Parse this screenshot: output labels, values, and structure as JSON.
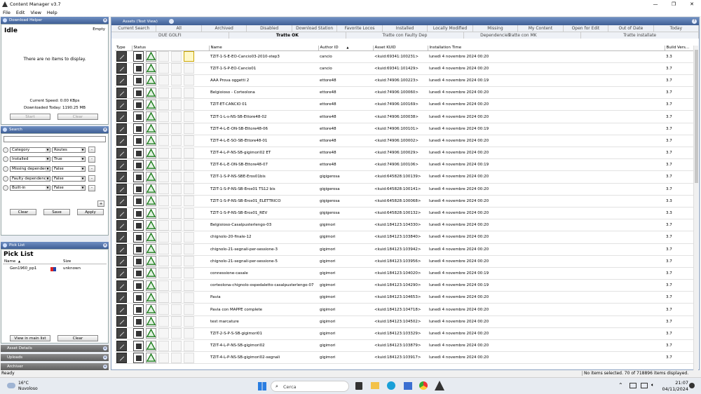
{
  "window": {
    "title": "Content Manager v3.7",
    "controls": [
      "—",
      "❐",
      "✕"
    ]
  },
  "menu": [
    "File",
    "Edit",
    "View",
    "Help"
  ],
  "download_helper": {
    "header": "Download Helper",
    "status": "Idle",
    "queue_state": "Empty",
    "empty_message": "There are no items to display.",
    "current_speed": "Current Speed: 0.00 KBps",
    "downloaded_today": "Downloaded Today: 1190.25 MB",
    "start_label": "Start",
    "clear_label": "Clear"
  },
  "search": {
    "header": "Search",
    "placeholder": "",
    "filters": [
      {
        "field": "Category",
        "value": "Routes"
      },
      {
        "field": "Installed",
        "value": "True"
      },
      {
        "field": "Missing dependenc",
        "value": "False"
      },
      {
        "field": "Faulty dependenci",
        "value": "False"
      },
      {
        "field": "Built-in",
        "value": "False"
      }
    ],
    "clear_label": "Clear",
    "save_label": "Save",
    "apply_label": "Apply"
  },
  "pick_list": {
    "header": "Pick List",
    "title": "Pick List",
    "columns": [
      "Name",
      "Size"
    ],
    "items": [
      {
        "name": "Gen1960_pp1",
        "size": "unknown"
      }
    ],
    "view_label": "View in main list",
    "clear_label": "Clear"
  },
  "collapsed_panels": [
    "Asset Details",
    "Uploads",
    "Archiver"
  ],
  "main": {
    "header": "Assets (Text View)",
    "tabs_row1": [
      "Current Search",
      "All",
      "Archived",
      "Disabled",
      "Download Station",
      "Favorite Locos",
      "Installed",
      "Locally Modified",
      "Missing Dependencies",
      "My Content",
      "Open for Edit",
      "Out of Date",
      "Today"
    ],
    "tabs_row2": [
      "DUE GOLFI",
      "Tratte OK",
      "Tratte con Faulty Dep",
      "Tratte con MK",
      "Tratte installate"
    ],
    "active_tab2": "Tratte OK",
    "columns": [
      "Type",
      "Status",
      "Name",
      "Author ID",
      "Asset KUID",
      "Installation Time",
      "Build Vers..."
    ],
    "rows": [
      {
        "name": "TZIT-1-S-E-EO-Cancio03-2010-step3",
        "author": "cancio",
        "kuid": "<kuid:69341:100231>",
        "time": "lunedì 4 novembre 2024 00:20",
        "build": "3.3",
        "warn": true
      },
      {
        "name": "TZIT-1-S-P-EO-Cancio01",
        "author": "cancio",
        "kuid": "<kuid:69341:101429>",
        "time": "lunedì 4 novembre 2024 00:20",
        "build": "3.7",
        "warn": false
      },
      {
        "name": "AAA Prova oggetti 2",
        "author": "ettore48",
        "kuid": "<kuid:74906:100223>",
        "time": "lunedì 4 novembre 2024 00:19",
        "build": "3.7",
        "warn": false
      },
      {
        "name": "Belgioioso - Corteolona",
        "author": "ettore48",
        "kuid": "<kuid:74906:100060>",
        "time": "lunedì 4 novembre 2024 00:20",
        "build": "3.7",
        "warn": false
      },
      {
        "name": "TZIT-ET-CANCIO 01",
        "author": "ettore48",
        "kuid": "<kuid:74906:100169>",
        "time": "lunedì 4 novembre 2024 00:20",
        "build": "3.7",
        "warn": false
      },
      {
        "name": "TZIT-1-L-s-NS-SB-Ettore48-02",
        "author": "ettore48",
        "kuid": "<kuid:74906:100038>",
        "time": "lunedì 4 novembre 2024 00:20",
        "build": "3.7",
        "warn": false
      },
      {
        "name": "TZIT-4-L-E-ON-SB-Ettore48-06",
        "author": "ettore48",
        "kuid": "<kuid:74906:100101>",
        "time": "lunedì 4 novembre 2024 00:19",
        "build": "3.7",
        "warn": false
      },
      {
        "name": "TZIT-4-L-E-SO-SB-Ettore48-01",
        "author": "ettore48",
        "kuid": "<kuid:74906:100002>",
        "time": "lunedì 4 novembre 2024 00:20",
        "build": "3.7",
        "warn": false
      },
      {
        "name": "TZIT-4-L-P-NS-SB-gigimori02 ET",
        "author": "ettore48",
        "kuid": "<kuid:74906:100029>",
        "time": "lunedì 4 novembre 2024 00:20",
        "build": "3.7",
        "warn": false
      },
      {
        "name": "TZIT-6-L-E-ON-SB-Ettore48-07",
        "author": "ettore48",
        "kuid": "<kuid:74906:100106>",
        "time": "lunedì 4 novembre 2024 00:19",
        "build": "3.7",
        "warn": false
      },
      {
        "name": "TZIT-1-S-P-NS-SBE-Eros01bis",
        "author": "gigigerosa",
        "kuid": "<kuid:645828:100139>",
        "time": "lunedì 4 novembre 2024 00:20",
        "build": "3.7",
        "warn": false
      },
      {
        "name": "TZIT-1-S-P-NS-SB-Eros01 TS12 bis",
        "author": "gigigerosa",
        "kuid": "<kuid:645828:100141>",
        "time": "lunedì 4 novembre 2024 00:20",
        "build": "3.7",
        "warn": false
      },
      {
        "name": "TZIT-1-S-P-NS-SB-Eros01_ELETTRICO",
        "author": "gigigerosa",
        "kuid": "<kuid:645828:100068>",
        "time": "lunedì 4 novembre 2024 00:20",
        "build": "3.3",
        "warn": false
      },
      {
        "name": "TZIT-1-S-P-NS-SB-Eros01_REV",
        "author": "gigigerosa",
        "kuid": "<kuid:645828:100132>",
        "time": "lunedì 4 novembre 2024 00:20",
        "build": "3.3",
        "warn": false
      },
      {
        "name": "Belgioioso-Casalpusterlengo-03",
        "author": "gigimori",
        "kuid": "<kuid:184123:104330>",
        "time": "lunedì 4 novembre 2024 00:20",
        "build": "3.7",
        "warn": false
      },
      {
        "name": "chignolo-20-finale-12",
        "author": "gigimori",
        "kuid": "<kuid:184123:103840>",
        "time": "lunedì 4 novembre 2024 00:20",
        "build": "3.7",
        "warn": false
      },
      {
        "name": "chignolo-21-segnali-per-sessione-3",
        "author": "gigimori",
        "kuid": "<kuid:184123:103942>",
        "time": "lunedì 4 novembre 2024 00:20",
        "build": "3.7",
        "warn": false
      },
      {
        "name": "chignolo-21-segnali-per-sessione-5",
        "author": "gigimori",
        "kuid": "<kuid:184123:103956>",
        "time": "lunedì 4 novembre 2024 00:20",
        "build": "3.7",
        "warn": false
      },
      {
        "name": "connessione-casale",
        "author": "gigimori",
        "kuid": "<kuid:184123:104020>",
        "time": "lunedì 4 novembre 2024 00:19",
        "build": "3.7",
        "warn": false
      },
      {
        "name": "corteolona-chignolo-ospedaletto-casalpusterlengo-07",
        "author": "gigimori",
        "kuid": "<kuid:184123:104290>",
        "time": "lunedì 4 novembre 2024 00:19",
        "build": "3.7",
        "warn": false
      },
      {
        "name": "Pavia",
        "author": "gigimori",
        "kuid": "<kuid:184123:104653>",
        "time": "lunedì 4 novembre 2024 00:20",
        "build": "3.7",
        "warn": false
      },
      {
        "name": "Pavia con MAPPE complete",
        "author": "gigimori",
        "kuid": "<kuid:184123:104718>",
        "time": "lunedì 4 novembre 2024 00:20",
        "build": "3.7",
        "warn": false
      },
      {
        "name": "test marcature",
        "author": "gigimori",
        "kuid": "<kuid:184123:104502>",
        "time": "lunedì 4 novembre 2024 00:20",
        "build": "3.7",
        "warn": false
      },
      {
        "name": "TZIT-2-S-P-S-SB-gigimori01",
        "author": "gigimori",
        "kuid": "<kuid:184123:103329>",
        "time": "lunedì 4 novembre 2024 00:20",
        "build": "3.7",
        "warn": false
      },
      {
        "name": "TZIT-4-L-P-NS-SB-gigimori02",
        "author": "gigimori",
        "kuid": "<kuid:184123:103879>",
        "time": "lunedì 4 novembre 2024 00:20",
        "build": "3.7",
        "warn": false
      },
      {
        "name": "TZIT-4-L-P-NS-SB-gigimori02-segnali",
        "author": "gigimori",
        "kuid": "<kuid:184123:103917>",
        "time": "lunedì 4 novembre 2024 00:20",
        "build": "3.7",
        "warn": false
      }
    ]
  },
  "statusbar": {
    "left": "Ready",
    "right": "No items selected. 70 of 718896 items displayed."
  },
  "taskbar": {
    "temperature": "16°C",
    "weather": "Nuvoloso",
    "search_placeholder": "Cerca",
    "time": "21:07",
    "date": "04/11/2024"
  }
}
